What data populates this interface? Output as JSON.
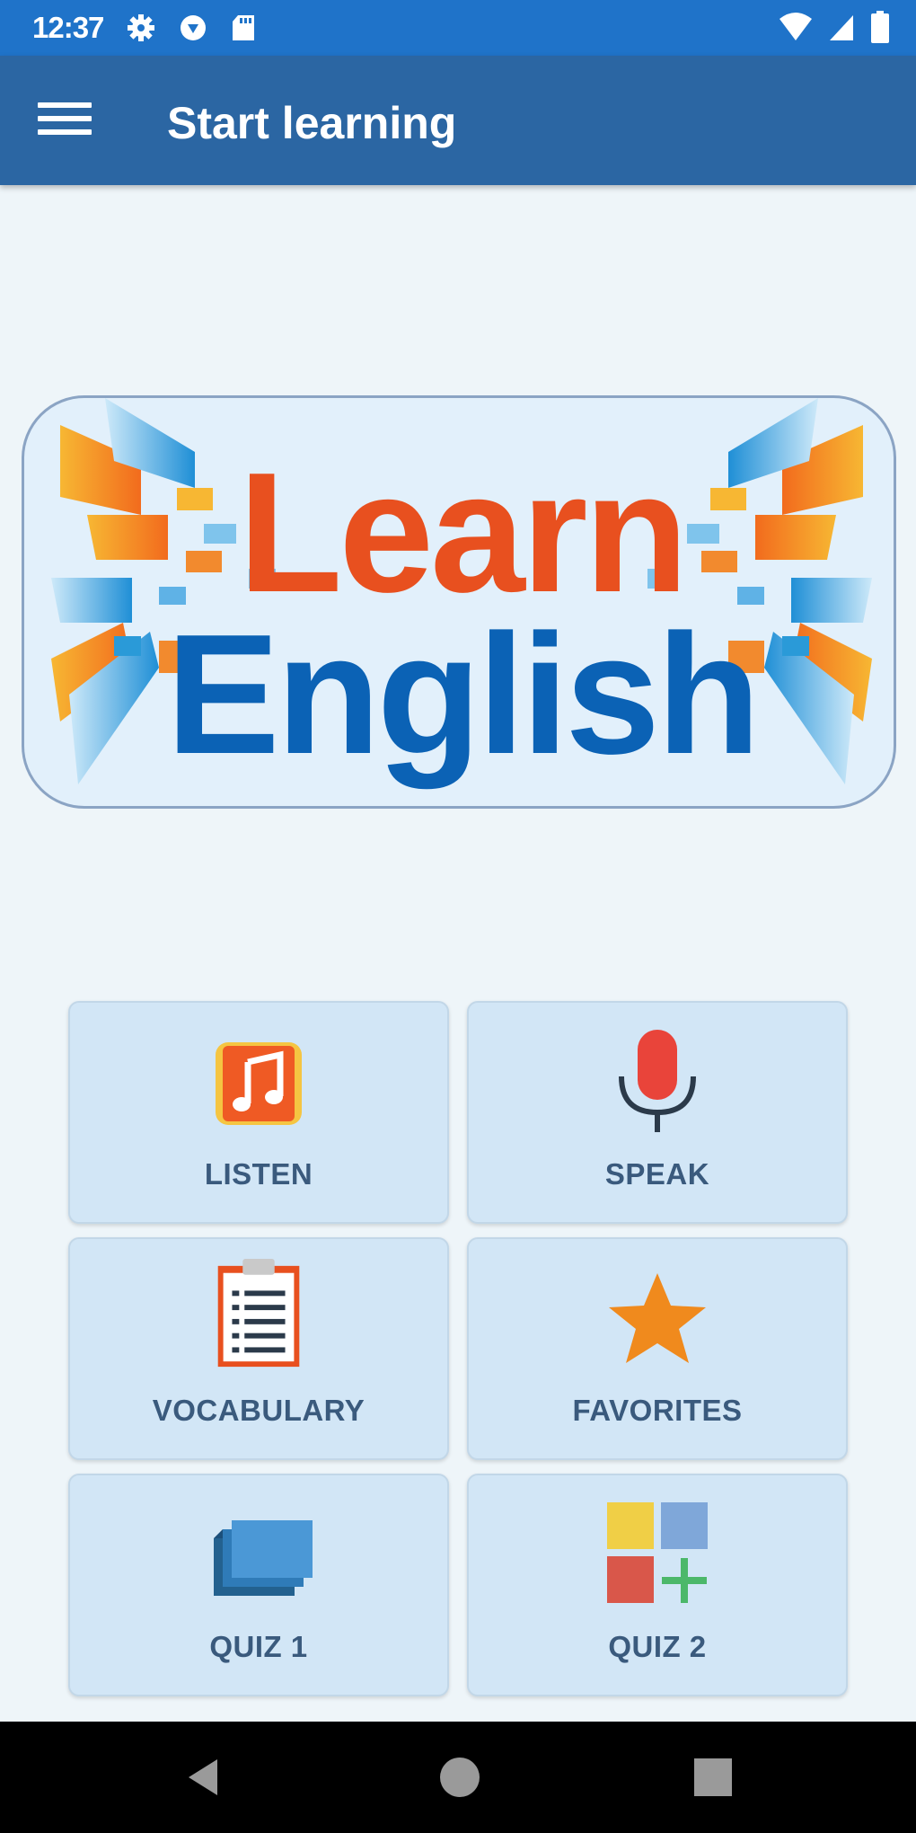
{
  "status_bar": {
    "time": "12:37",
    "icons_left": [
      "gear-icon",
      "shield-icon",
      "sd-card-icon"
    ],
    "icons_right": [
      "wifi-icon",
      "cell-signal-icon",
      "battery-icon"
    ]
  },
  "app_bar": {
    "title": "Start learning",
    "menu_icon": "hamburger-menu-icon"
  },
  "banner": {
    "line1": "Learn",
    "line2": "English"
  },
  "menu": [
    {
      "label": "LISTEN",
      "icon": "music-note-icon"
    },
    {
      "label": "SPEAK",
      "icon": "microphone-icon"
    },
    {
      "label": "VOCABULARY",
      "icon": "clipboard-list-icon"
    },
    {
      "label": "FAVORITES",
      "icon": "star-icon"
    },
    {
      "label": "QUIZ 1",
      "icon": "cards-stack-icon"
    },
    {
      "label": "QUIZ 2",
      "icon": "squares-plus-icon"
    }
  ],
  "nav_bar": {
    "buttons": [
      "back-icon",
      "home-icon",
      "recents-icon"
    ]
  },
  "colors": {
    "status_bar": "#1f73c9",
    "app_bar": "#2b66a3",
    "background": "#eef5f9",
    "tile": "#d2e6f6",
    "tile_label": "#3a5a7d"
  }
}
